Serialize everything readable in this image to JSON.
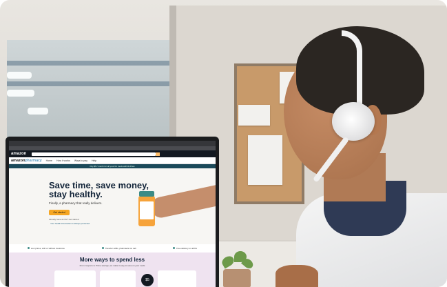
{
  "screen": {
    "nav_logo": "amazon",
    "subnav": {
      "brand_prefix": "amazon",
      "brand_suffix": "pharmacy",
      "links": [
        "Home",
        "How it works",
        "Ways to pay",
        "Help"
      ]
    },
    "promo_text": "Pay $5 / month for all your Rx meds with RxPass",
    "hero": {
      "headline_line1": "Save time, save money,",
      "headline_line2": "stay healthy.",
      "subtext": "Finally, a pharmacy that really delivers.",
      "cta_label": "Get started",
      "fine_print": "Already have an Rx? Get started",
      "link_text": "Your health information is always protected"
    },
    "features": [
      "Low prices, with or without insurance",
      "Transfer refills, pharmacist on call",
      "Free delivery on all Rx"
    ],
    "ways": {
      "title": "More ways to spend less",
      "description": "From coupons to Prime savings, we make it easy to save on your meds",
      "badge": "$5"
    }
  }
}
